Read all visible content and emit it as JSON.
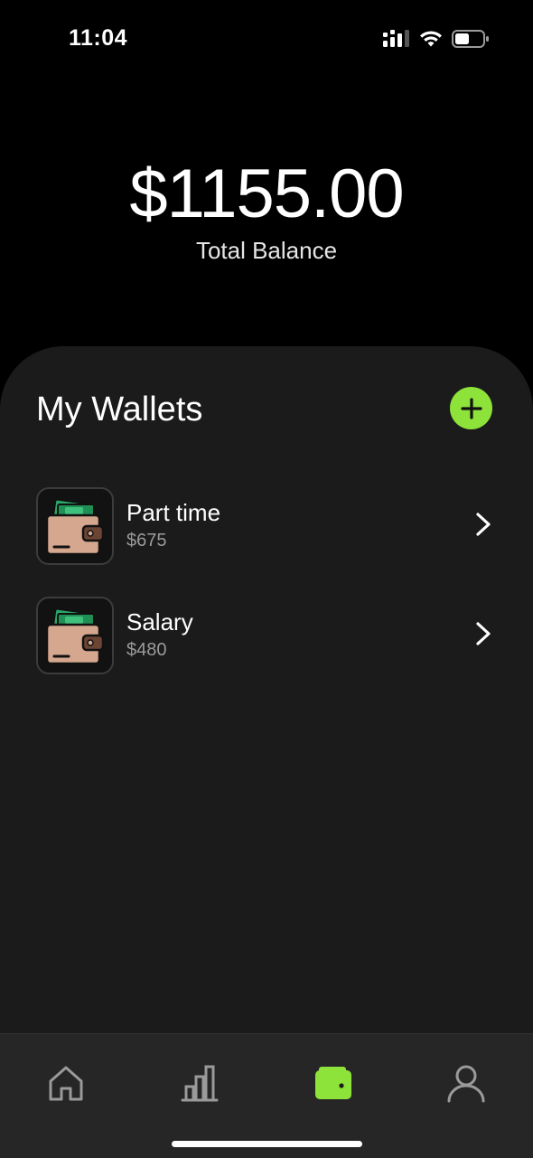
{
  "status_bar": {
    "time": "11:04"
  },
  "balance": {
    "amount": "$1155.00",
    "label": "Total Balance"
  },
  "wallets_section": {
    "title": "My Wallets",
    "add_icon": "plus-icon",
    "accent_color": "#8ee33a"
  },
  "wallets": [
    {
      "name": "Part time",
      "amount": "$675",
      "icon": "wallet-with-cash-icon"
    },
    {
      "name": "Salary",
      "amount": "$480",
      "icon": "wallet-with-cash-icon"
    }
  ],
  "tab_bar": {
    "tabs": [
      {
        "icon": "home-icon",
        "active": false
      },
      {
        "icon": "bar-chart-icon",
        "active": false
      },
      {
        "icon": "wallet-icon",
        "active": true
      },
      {
        "icon": "user-icon",
        "active": false
      }
    ]
  }
}
